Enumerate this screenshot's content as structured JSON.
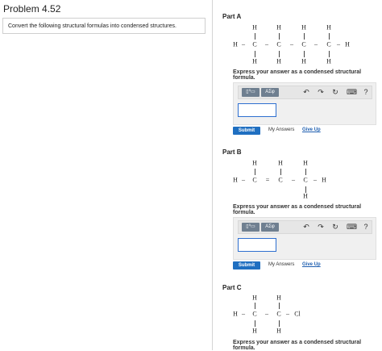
{
  "problem": {
    "title": "Problem 4.52",
    "instruction": "Convert the following structural formulas into condensed structures."
  },
  "parts": [
    {
      "title": "Part A",
      "atoms": {
        "H": "H",
        "C": "C",
        "dash": "–",
        "eq": "="
      },
      "express": "Express your answer as a condensed structural formula.",
      "toolbar": {
        "template": "▯⁰▭",
        "greek": "AΣφ",
        "undo": "↶",
        "redo": "↷",
        "reset": "↻",
        "keyboard": "⌨",
        "help": "?"
      },
      "submit": "Submit",
      "my_answers": "My Answers",
      "give_up": "Give Up"
    },
    {
      "title": "Part B",
      "atoms": {
        "H": "H",
        "C": "C",
        "dash": "–",
        "eq": "="
      },
      "express": "Express your answer as a condensed structural formula.",
      "toolbar": {
        "template": "▯⁰▭",
        "greek": "AΣφ",
        "undo": "↶",
        "redo": "↷",
        "reset": "↻",
        "keyboard": "⌨",
        "help": "?"
      },
      "submit": "Submit",
      "my_answers": "My Answers",
      "give_up": "Give Up"
    },
    {
      "title": "Part C",
      "atoms": {
        "H": "H",
        "C": "C",
        "dash": "–",
        "Cl": "Cl"
      },
      "express": "Express your answer as a condensed structural formula."
    }
  ]
}
